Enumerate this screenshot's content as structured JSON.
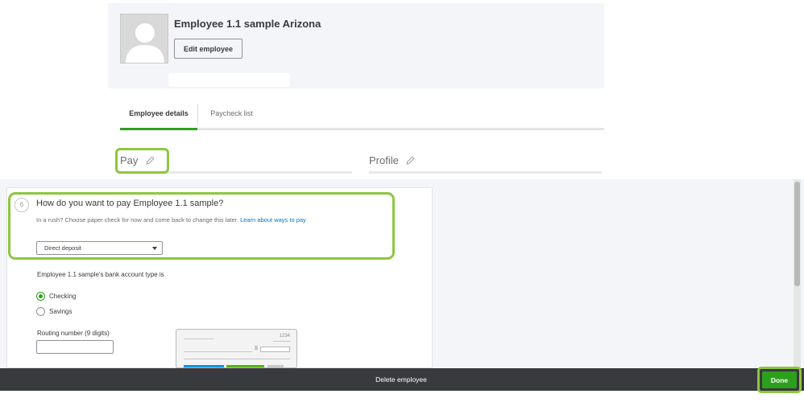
{
  "employee": {
    "name": "Employee 1.1 sample Arizona",
    "edit_label": "Edit employee"
  },
  "tabs": [
    {
      "label": "Employee details",
      "active": true
    },
    {
      "label": "Paycheck list",
      "active": false
    }
  ],
  "sections": {
    "pay": "Pay",
    "profile": "Profile"
  },
  "payment_step": {
    "step_number": "6",
    "question": "How do you want to pay Employee 1.1 sample?",
    "hint": "In a rush? Choose paper check for now and come back to change this later.",
    "hint_link": "Learn about ways to pay",
    "method_selected": "Direct deposit"
  },
  "bank": {
    "account_type_label": "Employee 1.1 sample's bank account type is",
    "options": [
      {
        "label": "Checking",
        "selected": true
      },
      {
        "label": "Savings",
        "selected": false
      }
    ],
    "routing_label": "Routing number (9 digits)",
    "routing_value": ""
  },
  "check_preview": {
    "number": "1234",
    "currency": "$"
  },
  "footer": {
    "delete_label": "Delete employee",
    "done_label": "Done"
  },
  "colors": {
    "brand_green": "#2ca01c",
    "highlight_green": "#8dc63f",
    "link_blue": "#0077c5",
    "footer_dark": "#393a3d"
  },
  "icons": {
    "avatar": "avatar-placeholder-icon",
    "edit": "pencil-icon",
    "select_caret": "caret-down-icon"
  }
}
